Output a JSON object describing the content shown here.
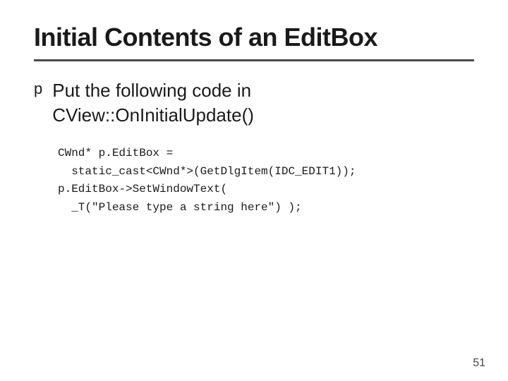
{
  "slide": {
    "title": "Initial Contents of an EditBox",
    "bullet": {
      "marker": "p",
      "text_line1": "Put the following code in",
      "text_line2": "CView::OnInitialUpdate()"
    },
    "code": {
      "line1": "CWnd* p.EditBox =",
      "line2": "  static_cast<CWnd*>(GetDlgItem(IDC_EDIT1));",
      "line3": "p.EditBox->SetWindowText(",
      "line4": "  _T(\"Please type a string here\") );"
    },
    "page_number": "51"
  }
}
